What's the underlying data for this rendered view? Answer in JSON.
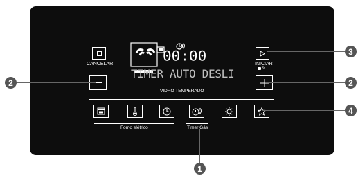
{
  "panel": {
    "cancel_label": "CANCELAR",
    "start_label": "INICIAR",
    "start_sub": "3s",
    "clock": "00:00",
    "message": "TIMER AUTO DESLI",
    "glass_label": "VIDRO TEMPERADO"
  },
  "groups": {
    "electric_oven": "Forno elétrico",
    "gas_timer": "Timer Gás"
  },
  "callouts": {
    "one": "1",
    "two_left": "2",
    "two_right": "2",
    "three": "3",
    "four": "4"
  },
  "colors": {
    "panel": "#0d0d0d",
    "foreground": "#ffffff",
    "callout": "#555555",
    "leader": "#666666"
  },
  "icons": [
    "stop-icon",
    "play-icon",
    "lock-icon",
    "minus-icon",
    "plus-icon",
    "oven-icon",
    "thermometer-icon",
    "clock-icon",
    "gas-timer-icon",
    "oven-light-icon",
    "favorite-icon",
    "burner-display-icon",
    "timer-indicator-icon"
  ]
}
